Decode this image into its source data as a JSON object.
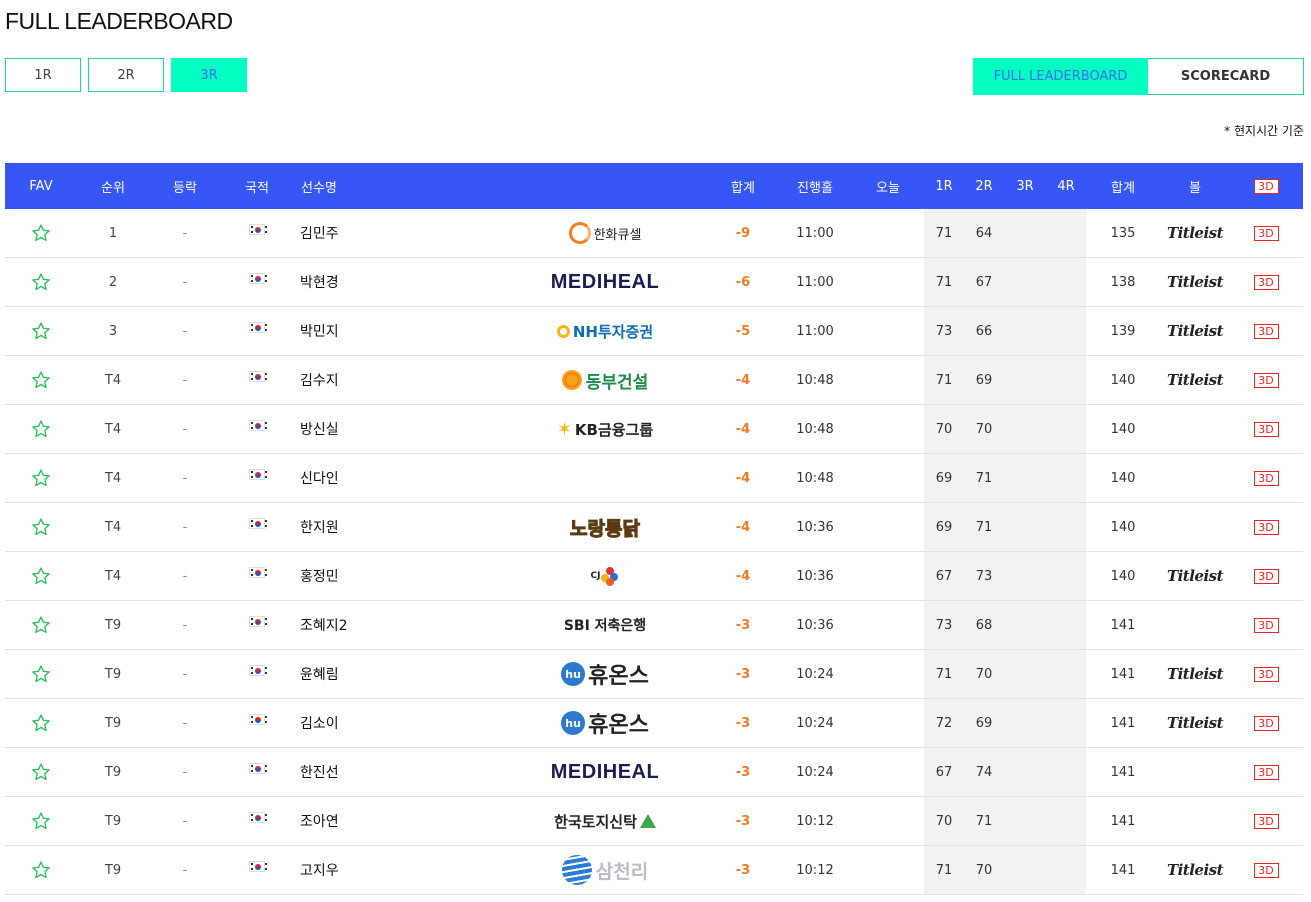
{
  "page_title": "FULL LEADERBOARD",
  "round_tabs": [
    {
      "label": "1R",
      "active": false
    },
    {
      "label": "2R",
      "active": false
    },
    {
      "label": "3R",
      "active": true
    }
  ],
  "view_tabs": {
    "full_label": "FULL LEADERBOARD",
    "scorecard_label": "SCORECARD"
  },
  "time_note": "* 현지시간 기준",
  "columns": {
    "fav": "FAV",
    "rank": "순위",
    "change": "등락",
    "nation": "국적",
    "player": "선수명",
    "total_to_par": "합계",
    "tee_time": "진행홀",
    "today": "오늘",
    "r1": "1R",
    "r2": "2R",
    "r3": "3R",
    "r4": "4R",
    "total": "합계",
    "ball": "볼",
    "view3d": "3D"
  },
  "rows": [
    {
      "rank": "1",
      "change": "-",
      "name": "김민주",
      "sponsor": "한화큐셀",
      "to_par": "-9",
      "time": "11:00",
      "r1": "71",
      "r2": "64",
      "total": "135",
      "ball": "Titleist",
      "view3d": "3D"
    },
    {
      "rank": "2",
      "change": "-",
      "name": "박현경",
      "sponsor": "MEDIHEAL",
      "to_par": "-6",
      "time": "11:00",
      "r1": "71",
      "r2": "67",
      "total": "138",
      "ball": "Titleist",
      "view3d": "3D"
    },
    {
      "rank": "3",
      "change": "-",
      "name": "박민지",
      "sponsor": "NH투자증권",
      "to_par": "-5",
      "time": "11:00",
      "r1": "73",
      "r2": "66",
      "total": "139",
      "ball": "Titleist",
      "view3d": "3D"
    },
    {
      "rank": "T4",
      "change": "-",
      "name": "김수지",
      "sponsor": "동부건설",
      "to_par": "-4",
      "time": "10:48",
      "r1": "71",
      "r2": "69",
      "total": "140",
      "ball": "Titleist",
      "view3d": "3D"
    },
    {
      "rank": "T4",
      "change": "-",
      "name": "방신실",
      "sponsor": "KB금융그룹",
      "to_par": "-4",
      "time": "10:48",
      "r1": "70",
      "r2": "70",
      "total": "140",
      "ball": "",
      "view3d": "3D"
    },
    {
      "rank": "T4",
      "change": "-",
      "name": "신다인",
      "sponsor": "",
      "to_par": "-4",
      "time": "10:48",
      "r1": "69",
      "r2": "71",
      "total": "140",
      "ball": "",
      "view3d": "3D"
    },
    {
      "rank": "T4",
      "change": "-",
      "name": "한지원",
      "sponsor": "노랑통닭",
      "to_par": "-4",
      "time": "10:36",
      "r1": "69",
      "r2": "71",
      "total": "140",
      "ball": "",
      "view3d": "3D"
    },
    {
      "rank": "T4",
      "change": "-",
      "name": "홍정민",
      "sponsor": "CJ",
      "to_par": "-4",
      "time": "10:36",
      "r1": "67",
      "r2": "73",
      "total": "140",
      "ball": "Titleist",
      "view3d": "3D"
    },
    {
      "rank": "T9",
      "change": "-",
      "name": "조혜지2",
      "sponsor": "SBI 저축은행",
      "to_par": "-3",
      "time": "10:36",
      "r1": "73",
      "r2": "68",
      "total": "141",
      "ball": "",
      "view3d": "3D"
    },
    {
      "rank": "T9",
      "change": "-",
      "name": "윤혜림",
      "sponsor": "휴온스",
      "to_par": "-3",
      "time": "10:24",
      "r1": "71",
      "r2": "70",
      "total": "141",
      "ball": "Titleist",
      "view3d": "3D"
    },
    {
      "rank": "T9",
      "change": "-",
      "name": "김소이",
      "sponsor": "휴온스",
      "to_par": "-3",
      "time": "10:24",
      "r1": "72",
      "r2": "69",
      "total": "141",
      "ball": "Titleist",
      "view3d": "3D"
    },
    {
      "rank": "T9",
      "change": "-",
      "name": "한진선",
      "sponsor": "MEDIHEAL",
      "to_par": "-3",
      "time": "10:24",
      "r1": "67",
      "r2": "74",
      "total": "141",
      "ball": "",
      "view3d": "3D"
    },
    {
      "rank": "T9",
      "change": "-",
      "name": "조아연",
      "sponsor": "한국토지신탁",
      "to_par": "-3",
      "time": "10:12",
      "r1": "70",
      "r2": "71",
      "total": "141",
      "ball": "",
      "view3d": "3D"
    },
    {
      "rank": "T9",
      "change": "-",
      "name": "고지우",
      "sponsor": "삼천리",
      "to_par": "-3",
      "time": "10:12",
      "r1": "71",
      "r2": "70",
      "total": "141",
      "ball": "Titleist",
      "view3d": "3D"
    }
  ],
  "colors": {
    "header_bg": "#3657f5",
    "accent": "#00ffc0",
    "accent_border": "#1fd1ad",
    "score": "#f07a26",
    "star": "#2bbf5c",
    "badge": "#ee2222"
  }
}
